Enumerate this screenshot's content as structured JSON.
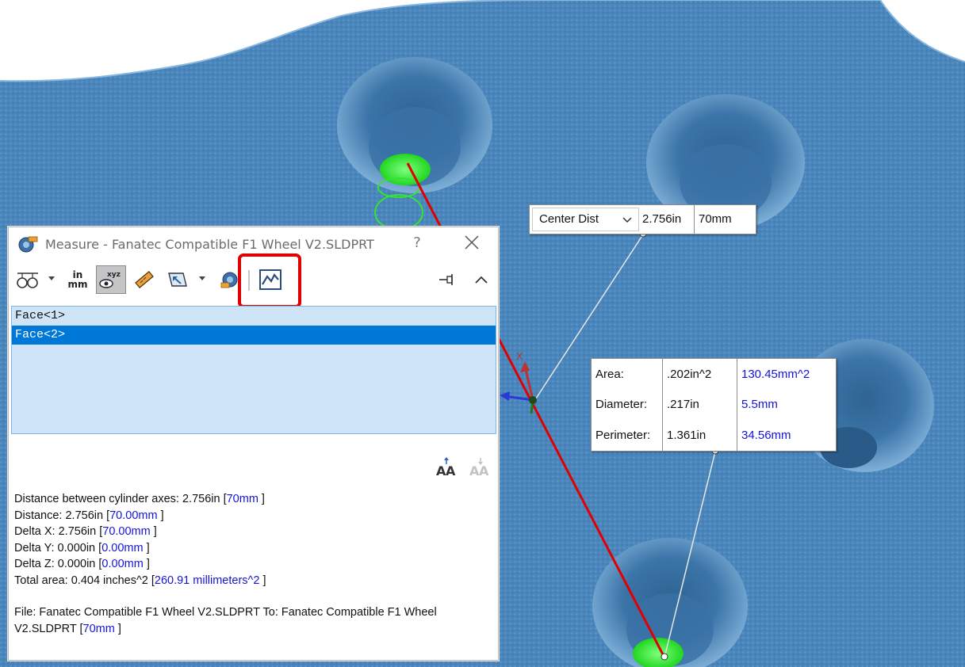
{
  "dialog": {
    "title": "Measure - Fanatec Compatible F1 Wheel V2.SLDPRT",
    "help": "?",
    "toolbar": {
      "units_top": "in",
      "units_bottom": "mm",
      "icons": [
        "arc-circle-options-icon",
        "units-precision-icon",
        "show-xyz-icon",
        "point-to-point-icon",
        "projection-icon",
        "measurement-history-icon",
        "create-sensor-icon",
        "pin-icon",
        "collapse-icon"
      ]
    },
    "selections": [
      "Face<1>",
      "Face<2>"
    ],
    "results": {
      "line1_label": "Distance between cylinder axes:  2.756in  [",
      "line1_mm": "70mm",
      "line2_label": "Distance: 2.756in  [",
      "line2_mm": "70.00mm",
      "line3_label": "Delta X: 2.756in  [",
      "line3_mm": "70.00mm",
      "line4_label": "Delta Y: 0.000in  [",
      "line4_mm": "0.00mm",
      "line5_label": "Delta Z: 0.000in  [",
      "line5_mm": "0.00mm",
      "line6_label": "Total area: 0.404 inches^2  [",
      "line6_mm": "260.91 millimeters^2",
      "file_label": "File: Fanatec Compatible F1 Wheel V2.SLDPRT To: Fanatec Compatible F1 Wheel V2.SLDPRT  [",
      "file_mm": "70mm",
      "close_bracket": " ]"
    }
  },
  "center_dist_callout": {
    "option": "Center Dist",
    "value_in": "2.756in",
    "value_mm": "70mm"
  },
  "face_callout": {
    "rows": [
      {
        "label": "Area:",
        "in": ".202in^2",
        "mm": "130.45mm^2"
      },
      {
        "label": "Diameter:",
        "in": ".217in",
        "mm": "5.5mm"
      },
      {
        "label": "Perimeter:",
        "in": "1.361in",
        "mm": "34.56mm"
      }
    ]
  },
  "triad": {
    "x_label": "X"
  },
  "colors": {
    "part_blue": "#4d88bd",
    "selection_green": "#2fe82f",
    "measure_line_red": "#e00000",
    "highlight_red": "#e00000",
    "mm_value_blue": "#1414d8",
    "list_selected": "#0078d7"
  }
}
